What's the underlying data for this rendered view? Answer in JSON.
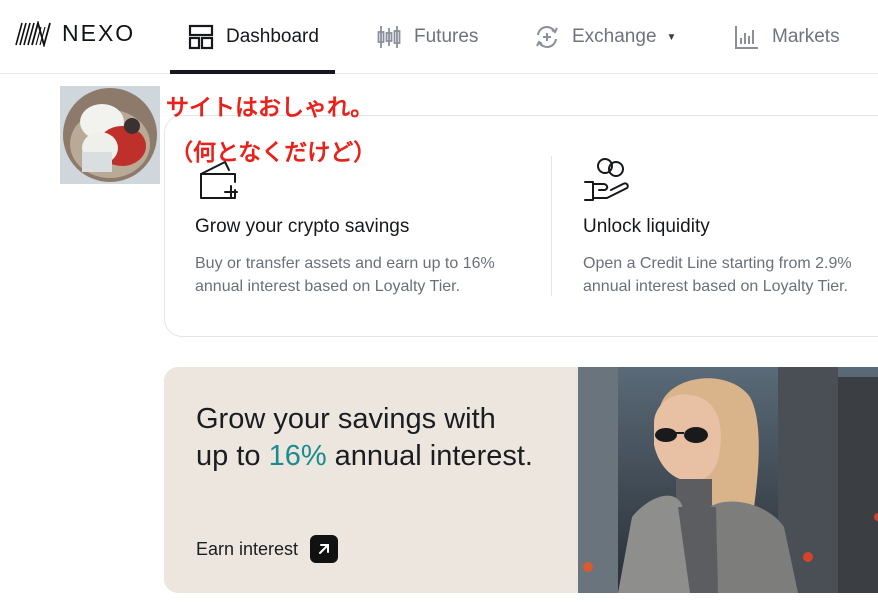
{
  "nav": {
    "brand": "NEXO",
    "items": [
      {
        "label": "Dashboard",
        "icon": "dashboard-icon",
        "active": true
      },
      {
        "label": "Futures",
        "icon": "candlestick-icon"
      },
      {
        "label": "Exchange",
        "icon": "exchange-icon",
        "has_dropdown": true
      },
      {
        "label": "Markets",
        "icon": "bar-chart-icon"
      }
    ]
  },
  "overlay": {
    "line1": "サイトはおしゃれ。",
    "line2": "（何となくだけど）"
  },
  "features": [
    {
      "title": "Grow your crypto savings",
      "desc_line1": "Buy or transfer assets and earn up to 16%",
      "desc_line2": "annual interest based on Loyalty Tier.",
      "icon": "wallet-plus-icon"
    },
    {
      "title": "Unlock liquidity",
      "desc_line1": "Open a Credit Line starting from 2.9%",
      "desc_line2": "annual interest based on Loyalty Tier.",
      "icon": "hand-coins-icon"
    }
  ],
  "promo": {
    "line1": "Grow your savings with",
    "line2_prefix": "up to ",
    "line2_accent": "16%",
    "line2_suffix": " annual interest.",
    "cta": "Earn interest",
    "accent_color": "#1a8c8f"
  }
}
